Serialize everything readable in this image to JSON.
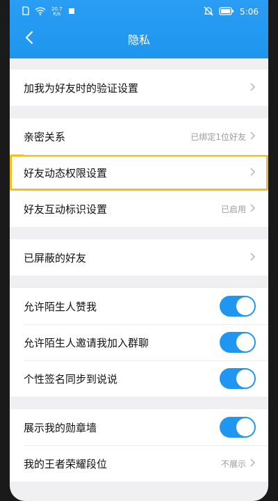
{
  "status": {
    "speed_top": "20.7",
    "speed_bottom": "K/s",
    "time": "5:06"
  },
  "nav": {
    "title": "隐私"
  },
  "groups": [
    {
      "items": [
        {
          "label": "加我为好友时的验证设置",
          "value": ""
        }
      ]
    },
    {
      "items": [
        {
          "label": "亲密关系",
          "value": "已绑定1位好友"
        },
        {
          "label": "好友动态权限设置",
          "value": ""
        },
        {
          "label": "好友互动标识设置",
          "value": "已启用"
        }
      ]
    },
    {
      "items": [
        {
          "label": "已屏蔽的好友",
          "value": ""
        }
      ]
    },
    {
      "items": [
        {
          "label": "允许陌生人赞我",
          "toggle": true
        },
        {
          "label": "允许陌生人邀请我加入群聊",
          "toggle": true
        },
        {
          "label": "个性签名同步到说说",
          "toggle": true
        }
      ]
    },
    {
      "items": [
        {
          "label": "展示我的勋章墙",
          "toggle": true
        },
        {
          "label": "我的王者荣耀段位",
          "value": "不展示"
        }
      ]
    }
  ],
  "colors": {
    "header": "#1e96ee",
    "toggle_on": "#1f97f2",
    "highlight": "#f5bf1b"
  }
}
